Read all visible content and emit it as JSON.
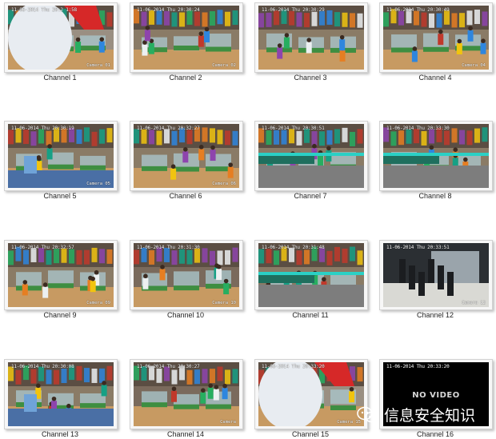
{
  "channels": [
    {
      "caption": "Channel 1",
      "stamp": "11-06-2014 Thu 20:2 1:58",
      "cam": "Camera 01",
      "scene": "closeup"
    },
    {
      "caption": "Channel 2",
      "stamp": "11-06-2014 Thu 20:30:24",
      "cam": "Camera 02",
      "scene": "store"
    },
    {
      "caption": "Channel 3",
      "stamp": "11-06-2014 Thu 20:30:29",
      "cam": "",
      "scene": "store"
    },
    {
      "caption": "Channel 4",
      "stamp": "11-06-2014 Thu 20:30:49",
      "cam": "Camera 04",
      "scene": "store"
    },
    {
      "caption": "Channel 5",
      "stamp": "11-06-2014 Thu 20:30:19",
      "cam": "Camera 05",
      "scene": "counter"
    },
    {
      "caption": "Channel 6",
      "stamp": "11-06-2014 Thu 20:32:27",
      "cam": "Camera 06",
      "scene": "store"
    },
    {
      "caption": "Channel 7",
      "stamp": "11-06-2014 Thu 20:30:51",
      "cam": "",
      "scene": "glitch"
    },
    {
      "caption": "Channel 8",
      "stamp": "11-06-2014 Thu 20:33:30",
      "cam": "",
      "scene": "glitch"
    },
    {
      "caption": "Channel 9",
      "stamp": "11-06-2014 Thu 20:32:57",
      "cam": "Camera 09",
      "scene": "store"
    },
    {
      "caption": "Channel 10",
      "stamp": "11-06-2014 Thu 20:31:30",
      "cam": "Camera 10",
      "scene": "aisle"
    },
    {
      "caption": "Channel 11",
      "stamp": "11-06-2014 Thu 20:31:48",
      "cam": "",
      "scene": "glitch"
    },
    {
      "caption": "Channel 12",
      "stamp": "11-06-2014 Thu 20:33:51",
      "cam": "Camera 12",
      "scene": "dark"
    },
    {
      "caption": "Channel 13",
      "stamp": "11-06-2014 Thu 20:30:08",
      "cam": "",
      "scene": "counter"
    },
    {
      "caption": "Channel 14",
      "stamp": "11-06-2014 Thu 20:30:27",
      "cam": "Camera",
      "scene": "aisle"
    },
    {
      "caption": "Channel 15",
      "stamp": "11-06-2014 Thu 20:33:20",
      "cam": "Camera 15",
      "scene": "closeup"
    },
    {
      "caption": "Channel 16",
      "stamp": "11-06-2014 Thu 20:33:20",
      "cam": "",
      "scene": "novideo",
      "no_video_text": "NO VIDEO"
    }
  ],
  "watermark": {
    "text": "信息安全知识",
    "icon": "wechat-icon"
  }
}
